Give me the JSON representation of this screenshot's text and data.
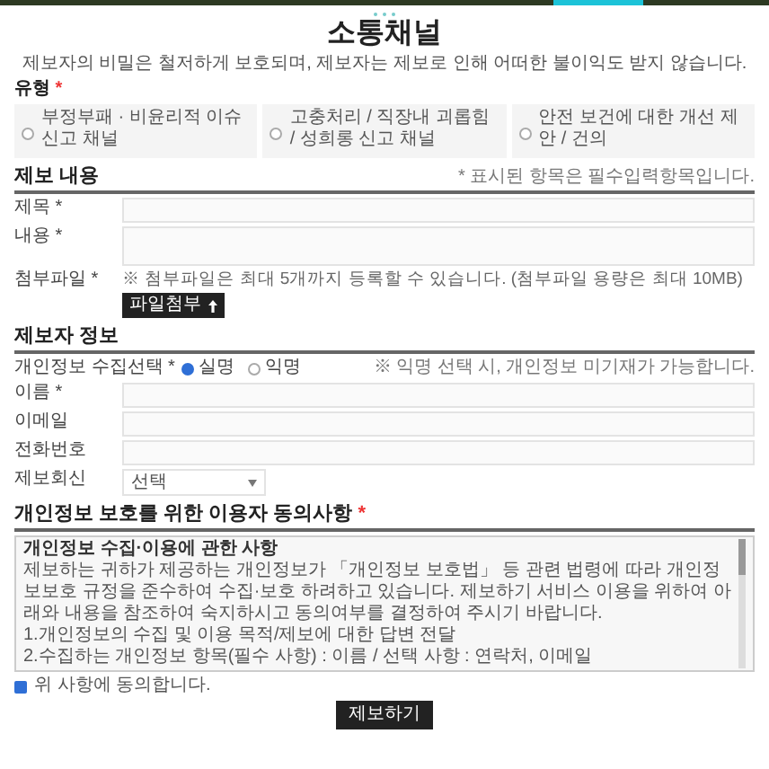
{
  "title": "소통채널",
  "subtitle": "제보자의 비밀은 철저하게 보호되며, 제보자는 제보로 인해 어떠한 불이익도 받지 않습니다.",
  "type_section": {
    "label": "유형",
    "required_mark": "*",
    "options": [
      {
        "label": "부정부패 · 비윤리적 이슈 신고 채널",
        "selected": false
      },
      {
        "label": "고충처리 / 직장내 괴롭힘 / 성희롱 신고 채널",
        "selected": false
      },
      {
        "label": "안전 보건에 대한 개선 제안 / 건의",
        "selected": false
      }
    ]
  },
  "report_section": {
    "heading": "제보 내용",
    "note": "* 표시된 항목은 필수입력항목입니다.",
    "fields": [
      {
        "kind": "input",
        "label": "제목 *"
      },
      {
        "kind": "textarea",
        "label": "내용 *"
      }
    ],
    "attachment": {
      "label": "첨부파일 *",
      "note": "※ 첨부파일은 최대 5개까지 등록할 수 있습니다. (첨부파일 용량은 최대 10MB)",
      "button": "파일첨부"
    }
  },
  "reporter_section": {
    "heading": "제보자 정보",
    "privacy_label": "개인정보 수집선택 *",
    "privacy_options": [
      {
        "label": "실명",
        "selected": true
      },
      {
        "label": "익명",
        "selected": false
      }
    ],
    "privacy_note": "※ 익명 선택 시, 개인정보 미기재가 가능합니다.",
    "fields": [
      {
        "kind": "input",
        "label": "이름 *"
      },
      {
        "kind": "input",
        "label": "이메일"
      },
      {
        "kind": "input",
        "label": "전화번호"
      },
      {
        "kind": "select",
        "label": "제보회신",
        "value": "선택"
      }
    ]
  },
  "consent_section": {
    "heading": "개인정보 보호를 위한 이용자 동의사항",
    "required_mark": "*",
    "box_title": "개인정보 수집·이용에 관한 사항",
    "box_lines": [
      "제보하는 귀하가 제공하는 개인정보가 「개인정보 보호법」 등 관련 법령에 따라 개인정보보호 규정을 준수하여 수집·보호 하려하고 있습니다. 제보하기 서비스 이용을 위하여 아래와 내용을 참조하여 숙지하시고 동의여부를 결정하여 주시기 바랍니다.",
      "1.개인정보의 수집 및 이용 목적/제보에 대한 답변 전달",
      "2.수집하는 개인정보 항목(필수 사항) : 이름 / 선택 사항 : 연락처, 이메일"
    ],
    "agree": {
      "label": "위 사항에 동의합니다.",
      "checked": true
    }
  },
  "submit": "제보하기"
}
